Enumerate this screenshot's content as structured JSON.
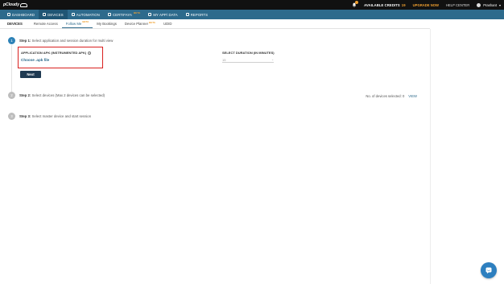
{
  "app": {
    "logo_text": "pCloudy"
  },
  "topbar": {
    "credits_label": "AVAILABLE CREDITS",
    "credits_value": "19",
    "upgrade_label": "UPGRADE NOW",
    "help_label": "HELP CENTER",
    "user_name": "Prashant",
    "icons": [
      "bell-icon",
      "avatar-icon",
      "chevron-down-icon"
    ]
  },
  "nav": {
    "items": [
      {
        "label": "DASHBOARD",
        "icon": "home-icon"
      },
      {
        "label": "DEVICES",
        "icon": "phone-icon",
        "active": true
      },
      {
        "label": "AUTOMATION",
        "icon": "wrench-icon"
      },
      {
        "label": "CERTIFAYA",
        "icon": "cloud-icon",
        "badge": "BETA"
      },
      {
        "label": "MY APP/ DATA",
        "icon": "folder-icon"
      },
      {
        "label": "REPORTS",
        "icon": "report-icon"
      }
    ]
  },
  "subnav": {
    "title": "DEVICES",
    "tabs": [
      {
        "label": "Remote Access"
      },
      {
        "label": "Follow Me",
        "badge": "BETA",
        "active": true
      },
      {
        "label": "My Bookings"
      },
      {
        "label": "Device Planner",
        "badge": "BETA"
      },
      {
        "label": "UDID"
      }
    ]
  },
  "steps": [
    {
      "num": "1",
      "title": "Step 1:",
      "text": "Select application and session duration for multi view",
      "active": true
    },
    {
      "num": "2",
      "title": "Step 2:",
      "text": "Select devices (Max 2 devices can be selected)",
      "active": false
    },
    {
      "num": "3",
      "title": "Step 3:",
      "text": "Select master device and start session",
      "active": false
    }
  ],
  "apk": {
    "label": "APPLICATION APK (INSTRUMENTED APK)",
    "info_glyph": "i",
    "choose_label": "Choose .apk file"
  },
  "duration": {
    "label": "SELECT DURATION (IN MINUTES)",
    "value": "15"
  },
  "next_label": "Next",
  "devices_selected": {
    "label": "No. of devices selected: 0",
    "view_label": "VIEW"
  },
  "colors": {
    "topbar": "#111111",
    "navbar": "#2d6a8c",
    "accent": "#f0a030",
    "highlight_border": "#d9201f",
    "step_active": "#2d82b7",
    "button": "#1f3a52"
  }
}
